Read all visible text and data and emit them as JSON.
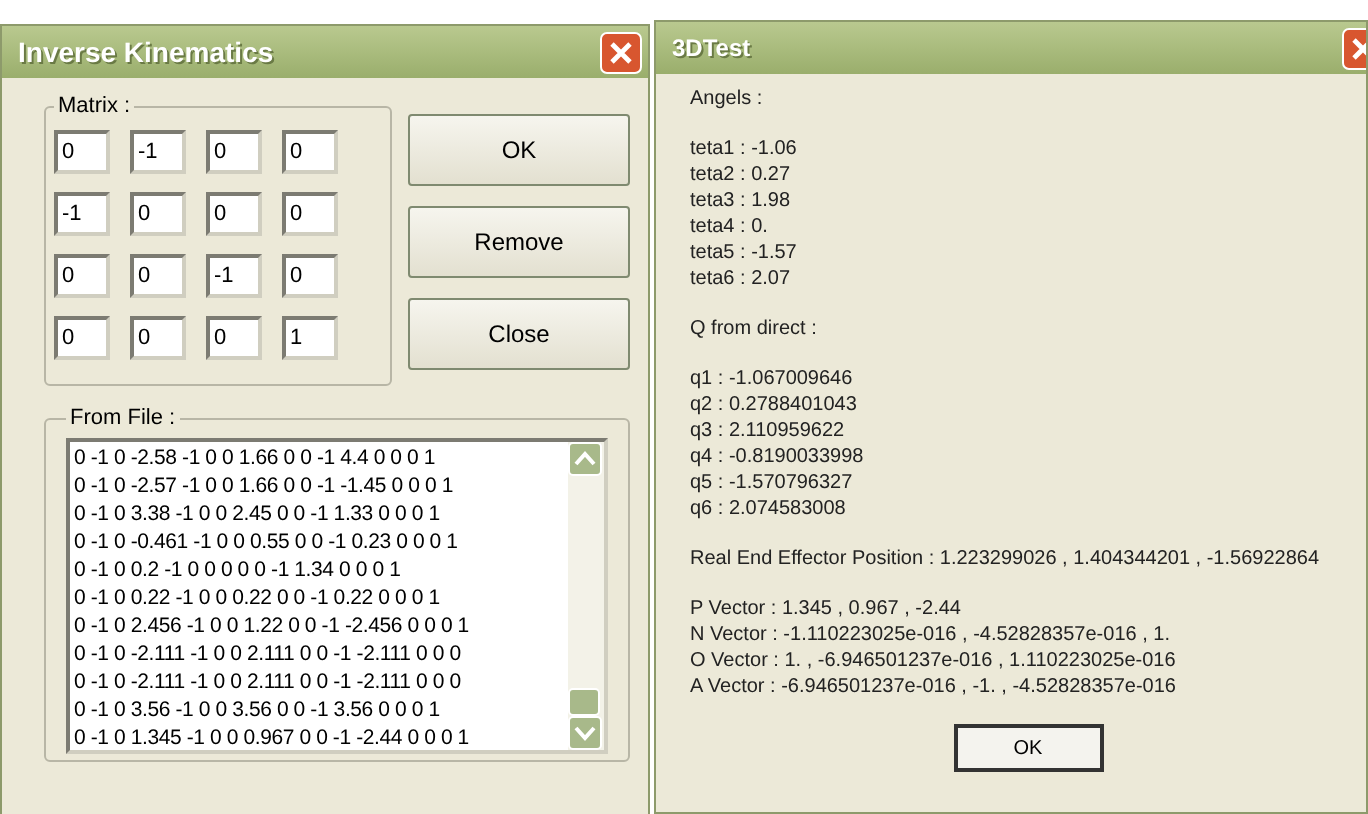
{
  "ik_window": {
    "title": "Inverse Kinematics",
    "matrix": {
      "label": "Matrix :",
      "rows": [
        [
          "0",
          "-1",
          "0",
          "0"
        ],
        [
          "-1",
          "0",
          "0",
          "0"
        ],
        [
          "0",
          "0",
          "-1",
          "0"
        ],
        [
          "0",
          "0",
          "0",
          "1"
        ]
      ]
    },
    "buttons": [
      "OK",
      "Remove",
      "Close"
    ],
    "from_file": {
      "label": "From File :",
      "lines": [
        "0 -1 0 -2.58 -1 0 0 1.66 0 0 -1 4.4 0 0 0 1",
        "0 -1 0 -2.57 -1 0 0 1.66 0 0 -1 -1.45 0 0 0 1",
        "0 -1 0 3.38 -1 0 0 2.45 0 0 -1 1.33 0 0 0 1",
        "0 -1 0 -0.461 -1 0 0 0.55 0 0 -1 0.23 0 0 0 1",
        "0 -1 0 0.2 -1 0 0 0 0 0 -1 1.34 0 0 0 1",
        "0 -1 0 0.22 -1 0 0 0.22 0 0 -1 0.22 0 0 0 1",
        "0 -1 0 2.456 -1 0 0 1.22 0 0 -1 -2.456 0 0 0 1",
        "0 -1 0 -2.111 -1 0 0 2.111 0 0 -1 -2.111 0 0 0",
        "0 -1 0 -2.111 -1 0 0 2.111 0 0 -1 -2.111 0 0 0",
        "0 -1 0 3.56 -1 0 0 3.56 0 0 -1 3.56 0 0 0 1",
        "0 -1 0 1.345 -1 0 0 0.967 0 0 -1 -2.44 0 0 0 1"
      ]
    }
  },
  "test_window": {
    "title": "3DTest",
    "sections": [
      [
        "Angels :"
      ],
      [
        "teta1 : -1.06",
        "teta2 : 0.27",
        "teta3 : 1.98",
        "teta4 : 0.",
        "teta5 : -1.57",
        "teta6 : 2.07"
      ],
      [
        "Q from direct :"
      ],
      [
        "q1 : -1.067009646",
        "q2 : 0.2788401043",
        "q3 : 2.110959622",
        "q4 : -0.8190033998",
        "q5 : -1.570796327",
        "q6 : 2.074583008"
      ],
      [
        "Real End Effector Position : 1.223299026 , 1.404344201 , -1.56922864"
      ],
      [
        "P Vector : 1.345 , 0.967 , -2.44",
        "N Vector : -1.110223025e-016 , -4.52828357e-016 , 1.",
        "O Vector : 1. , -6.946501237e-016 , 1.110223025e-016",
        "A Vector : -6.946501237e-016 , -1. , -4.52828357e-016"
      ]
    ],
    "button": "OK"
  }
}
